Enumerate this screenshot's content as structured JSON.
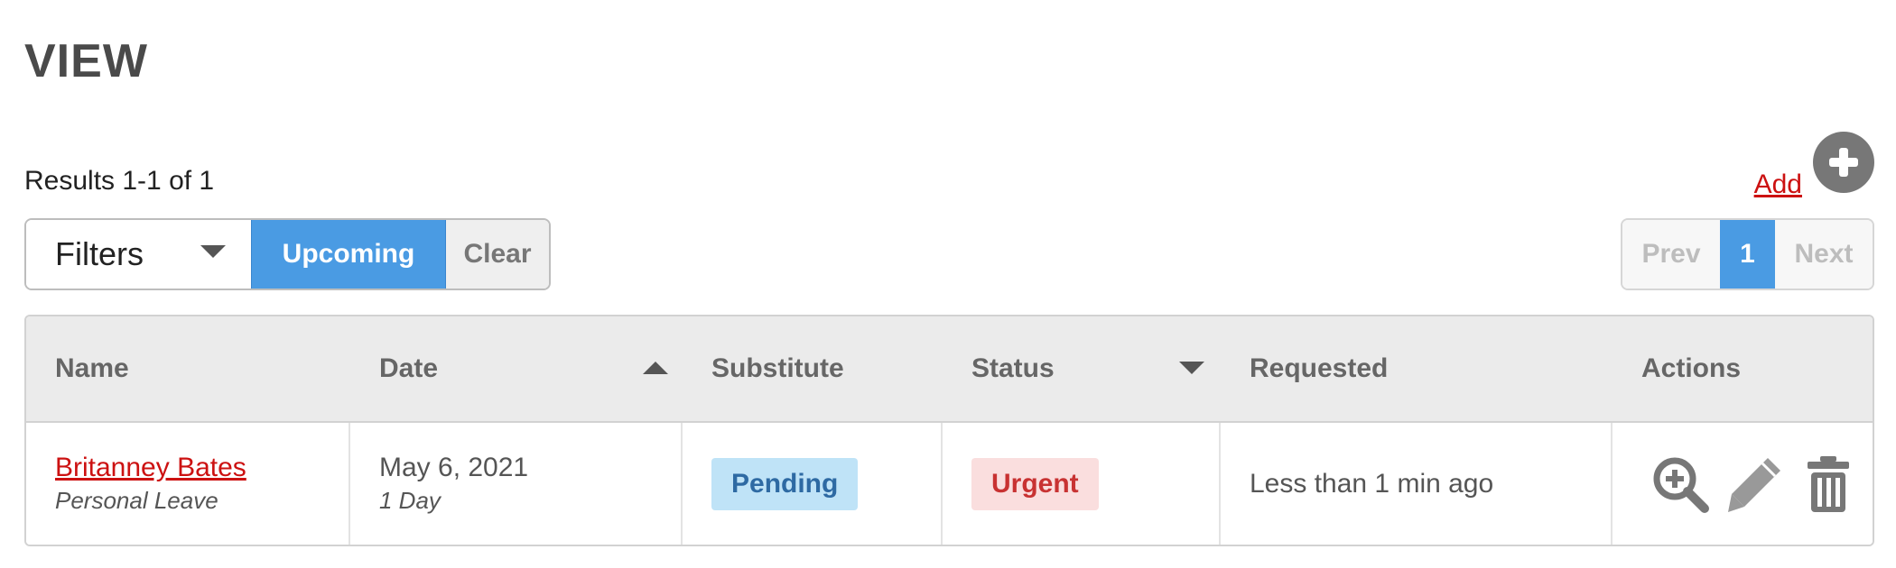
{
  "page": {
    "title": "VIEW"
  },
  "results": {
    "text": "Results 1-1 of 1"
  },
  "add": {
    "label": "Add"
  },
  "filters": {
    "select_label": "Filters",
    "upcoming_label": "Upcoming",
    "clear_label": "Clear"
  },
  "pagination": {
    "prev": "Prev",
    "current": "1",
    "next": "Next"
  },
  "table": {
    "headers": {
      "name": "Name",
      "date": "Date",
      "substitute": "Substitute",
      "status": "Status",
      "requested": "Requested",
      "actions": "Actions"
    },
    "rows": [
      {
        "name": "Britanney Bates",
        "type": "Personal Leave",
        "date": "May 6, 2021",
        "duration": "1 Day",
        "substitute": "Pending",
        "status": "Urgent",
        "requested": "Less than 1 min ago"
      }
    ]
  },
  "icons": {
    "add": "plus-circle-icon",
    "view": "zoom-in-icon",
    "edit": "pencil-icon",
    "delete": "trash-icon"
  },
  "colors": {
    "accent": "#4a9be3",
    "link": "#cc1111",
    "pending_bg": "#bfe3f7",
    "urgent_bg": "#fadede"
  }
}
